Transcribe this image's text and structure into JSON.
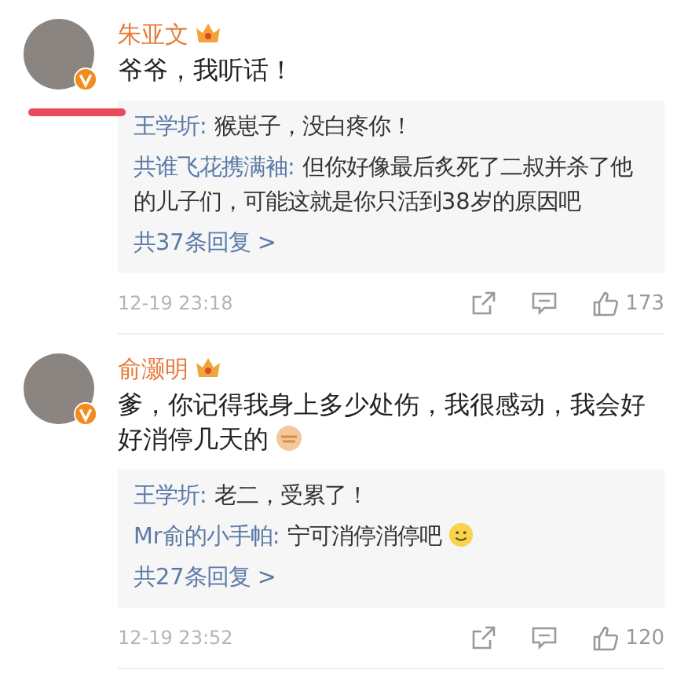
{
  "comments": [
    {
      "author": "朱亚文",
      "verified": true,
      "underlined": true,
      "text": "爷爷，我听话！",
      "replies": [
        {
          "author": "王学圻:",
          "text": "猴崽子，没白疼你！"
        },
        {
          "author": "共谁飞花携满袖:",
          "text": "但你好像最后炙死了二叔并杀了他的儿子们，可能这就是你只活到38岁的原因吧"
        }
      ],
      "more_replies": "共37条回复 >",
      "time": "12-19 23:18",
      "likes": "173"
    },
    {
      "author": "俞灏明",
      "verified": true,
      "underlined": false,
      "text": "爹，你记得我身上多少处伤，我很感动，我会好好消停几天的",
      "trailing_emoji": {
        "kind": "fist"
      },
      "replies": [
        {
          "author": "王学圻:",
          "text": "老二，受累了！"
        },
        {
          "author": "Mr俞的小手帕:",
          "text": "宁可消停消停吧",
          "trailing_emoji": {
            "kind": "smile"
          }
        }
      ],
      "more_replies": "共27条回复 >",
      "time": "12-19 23:52",
      "likes": "120"
    }
  ]
}
